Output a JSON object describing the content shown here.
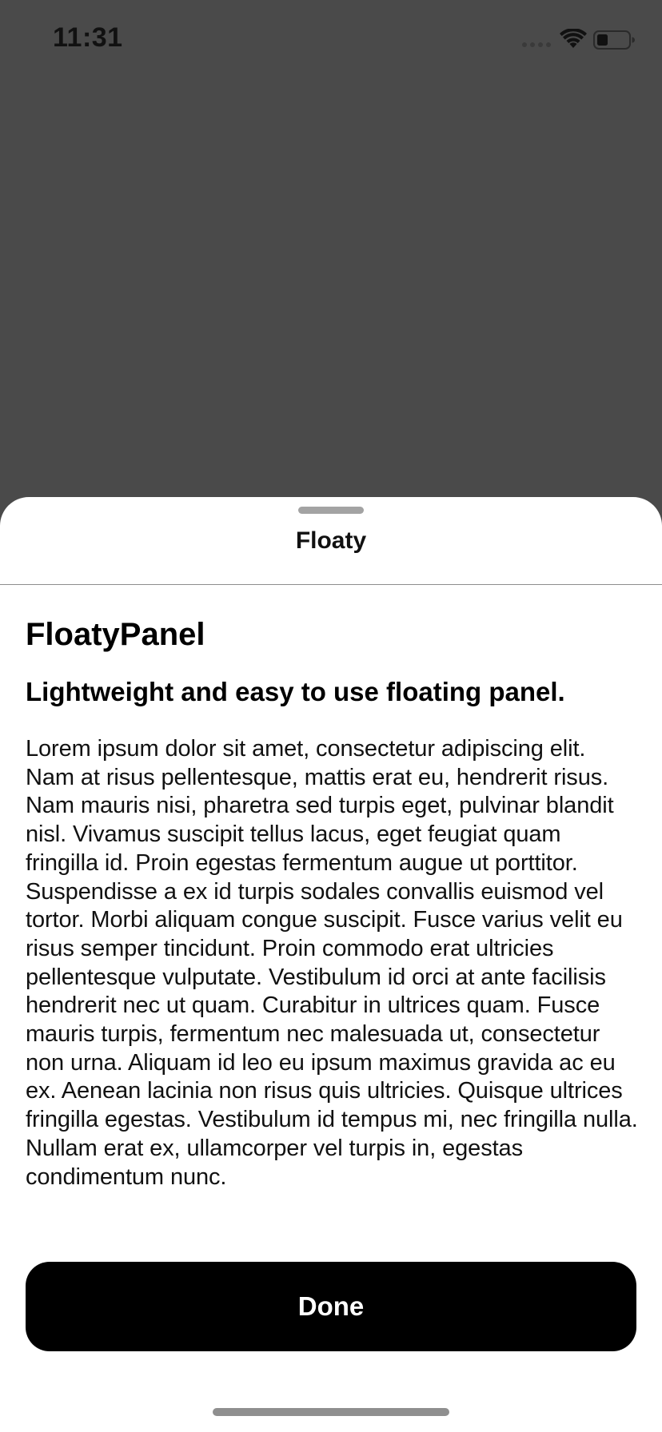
{
  "status_bar": {
    "time": "11:31",
    "icons": [
      "cellular-signal-icon",
      "wifi-icon",
      "battery-icon"
    ]
  },
  "panel": {
    "title": "Floaty",
    "heading": "FloatyPanel",
    "subheading": "Lightweight and easy to use floating panel.",
    "body": "Lorem ipsum dolor sit amet, consectetur adipiscing elit. Nam at risus pellentesque, mattis erat eu, hendrerit risus. Nam mauris nisi, pharetra sed turpis eget, pulvinar blandit nisl. Vivamus suscipit tellus lacus, eget feugiat quam fringilla id. Proin egestas fermentum augue ut porttitor. Suspendisse a ex id turpis sodales convallis euismod vel tortor. Morbi aliquam congue suscipit. Fusce varius velit eu risus semper tincidunt. Proin commodo erat ultricies pellentesque vulputate. Vestibulum id orci at ante facilisis hendrerit nec ut quam. Curabitur in ultrices quam. Fusce mauris turpis, fermentum nec malesuada ut, consectetur non urna. Aliquam id leo eu ipsum maximus gravida ac eu ex. Aenean lacinia non risus quis ultricies. Quisque ultrices fringilla egestas. Vestibulum id tempus mi, nec fringilla nulla. Nullam erat ex, ullamcorper vel turpis in, egestas condimentum nunc.",
    "done_label": "Done"
  },
  "colors": {
    "backdrop": "#4a4a4a",
    "panel_background": "#ffffff",
    "button_background": "#000000",
    "button_text": "#ffffff"
  }
}
